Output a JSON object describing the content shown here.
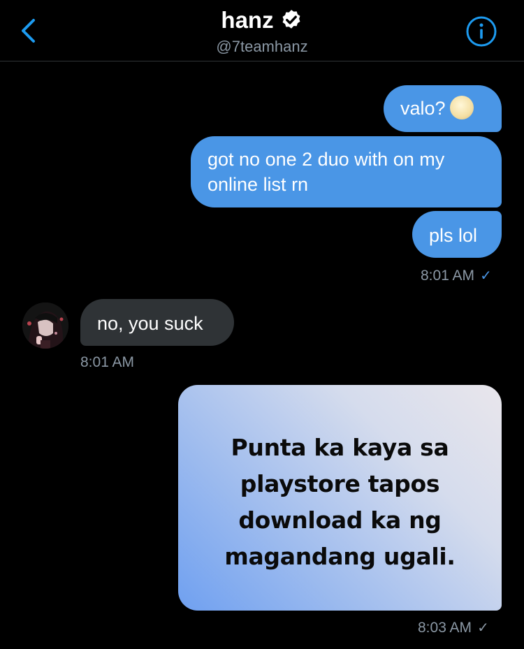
{
  "header": {
    "name": "hanz",
    "handle": "@7teamhanz",
    "icons": {
      "back": "chevron-left-icon",
      "verified": "verified-badge-icon",
      "info": "info-icon"
    }
  },
  "messages": [
    {
      "direction": "outgoing",
      "text": "valo?",
      "emoji": "grimacing-face-emoji"
    },
    {
      "direction": "outgoing",
      "text": "got no one 2 duo with on my online list rn"
    },
    {
      "direction": "outgoing",
      "text": "pls lol"
    },
    {
      "direction": "incoming",
      "text": "no, you suck"
    },
    {
      "direction": "outgoing",
      "type": "image",
      "lines": [
        "Punta ka kaya sa",
        "playstore tapos",
        "download ka ng",
        "magandang ugali."
      ]
    }
  ],
  "timestamps": {
    "first_group": "8:01 AM",
    "incoming": "8:01 AM",
    "last": "8:03 AM"
  },
  "read_receipt": "✓",
  "colors": {
    "background": "#000000",
    "outgoing_bubble": "#4a96e6",
    "incoming_bubble": "#2f3336",
    "secondary_text": "#8b98a5",
    "accent": "#1d9bf0"
  }
}
